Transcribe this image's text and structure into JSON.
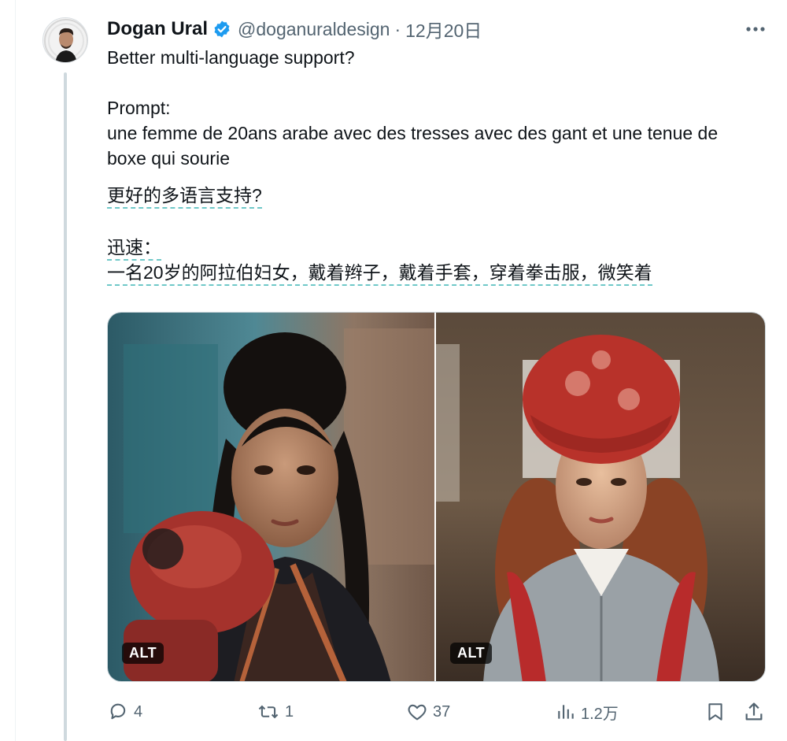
{
  "tweet": {
    "author": {
      "display_name": "Dogan Ural",
      "handle": "@doganuraldesign",
      "verified": true,
      "verified_color": "#1d9bf0"
    },
    "separator": "·",
    "date": "12月20日",
    "text_lines": [
      "Better multi-language support?",
      "Prompt:",
      "une femme de 20ans arabe avec des tresses avec des gant et une tenue de",
      "boxe qui sourie"
    ],
    "translation_lines": [
      "更好的多语言支持?",
      "迅速：",
      "一名20岁的阿拉伯妇女，戴着辫子，戴着手套，穿着拳击服，微笑着"
    ],
    "media": [
      {
        "alt_badge": "ALT"
      },
      {
        "alt_badge": "ALT"
      }
    ],
    "actions": {
      "replies": "4",
      "retweets": "1",
      "likes": "37",
      "views": "1.2万"
    }
  },
  "icons": {
    "more": "more-dots-icon",
    "reply": "reply-icon",
    "retweet": "retweet-icon",
    "like": "heart-icon",
    "views": "views-chart-icon",
    "bookmark": "bookmark-icon",
    "share": "share-icon"
  }
}
